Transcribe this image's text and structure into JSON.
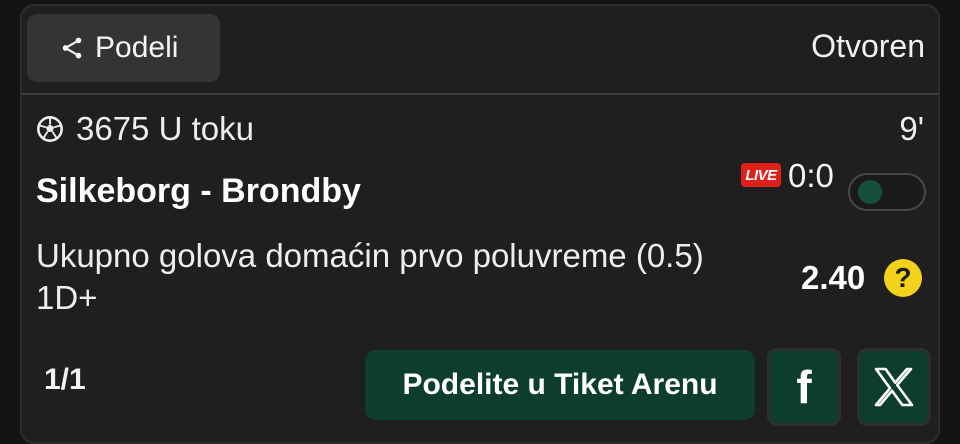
{
  "header": {
    "share_label": "Podeli",
    "status": "Otvoren"
  },
  "event": {
    "code": "3675",
    "state": "U toku",
    "code_state": "3675 U toku",
    "minute": "9'",
    "match": "Silkeborg - Brondby",
    "live_badge": "LIVE",
    "score": "0:0",
    "toggle_on": false
  },
  "bet": {
    "market": "Ukupno golova domaćin prvo poluvreme (0.5) 1D+",
    "odd": "2.40",
    "help_symbol": "?"
  },
  "footer": {
    "pager": "1/1",
    "arena_button": "Podelite u Tiket Arenu",
    "facebook_symbol": "f"
  },
  "icons": {
    "share": "share-icon",
    "sport": "soccer-ball-icon",
    "facebook": "facebook-icon",
    "x": "x-logo-icon"
  },
  "colors": {
    "background": "#131313",
    "card": "#1f1f1f",
    "live_red": "#e0201b",
    "brand_green": "#0d3e2c",
    "help_yellow": "#f3d21c"
  }
}
